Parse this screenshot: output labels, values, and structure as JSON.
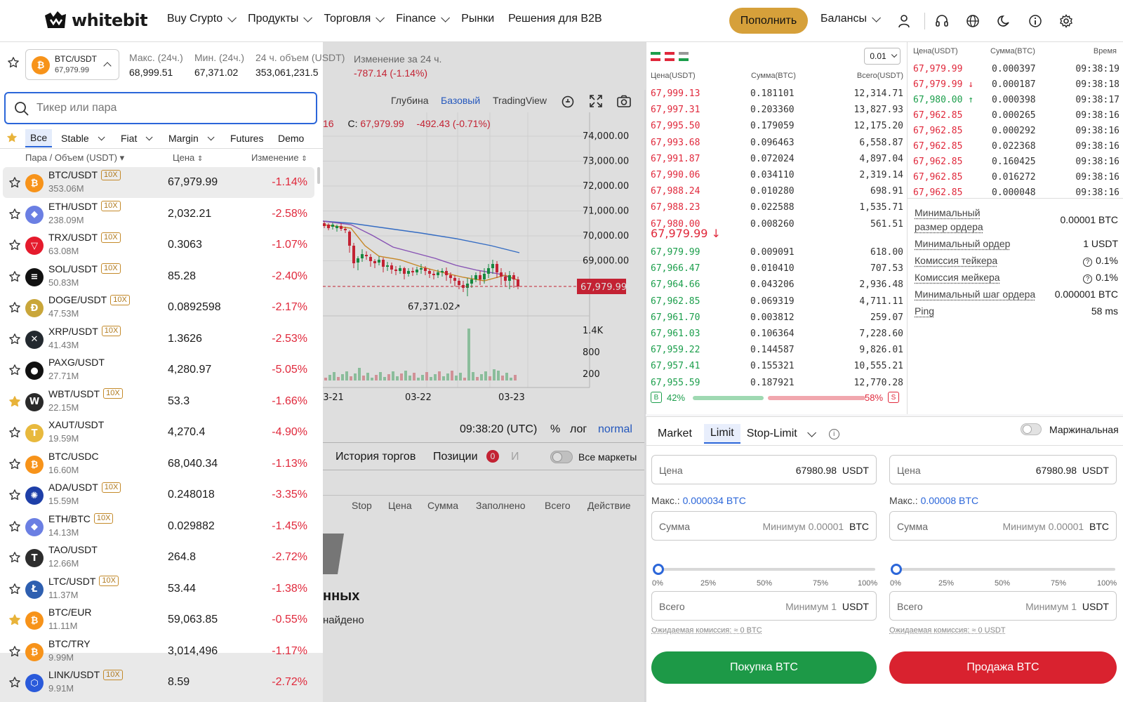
{
  "header": {
    "logo_text": "whitebit",
    "nav": [
      {
        "label": "Buy Crypto",
        "dropdown": true
      },
      {
        "label": "Продукты",
        "dropdown": true
      },
      {
        "label": "Торговля",
        "dropdown": true
      },
      {
        "label": "Finance",
        "dropdown": true
      },
      {
        "label": "Рынки",
        "dropdown": false
      },
      {
        "label": "Решения для B2B",
        "dropdown": false
      }
    ],
    "deposit_label": "Пополнить",
    "balances_label": "Балансы"
  },
  "colors": {
    "accent": "#d6a03a",
    "blue": "#2b66d9",
    "red": "#e0283b",
    "green": "#1b9e4b"
  },
  "market_panel": {
    "current_pair": "BTC/USDT",
    "current_price": "67,979.99",
    "stats": [
      {
        "label": "Макс. (24ч.)",
        "value": "68,999.51"
      },
      {
        "label": "Мин. (24ч.)",
        "value": "67,371.02"
      },
      {
        "label": "24 ч. объем (USDT)",
        "value": "353,061,231.5"
      },
      {
        "label": "Изменение за 24 ч.",
        "value": "-787.14  (-1.14%)"
      }
    ],
    "search_placeholder": "Тикер или пара",
    "filters": [
      "Все",
      "Stable",
      "Fiat",
      "Margin",
      "Futures",
      "Demo"
    ],
    "col_pair": "Пара / Объем (USDT)",
    "col_price": "Цена",
    "col_change": "Изменение",
    "rows": [
      {
        "pair": "BTC/USDT",
        "lev": "10X",
        "vol": "353.06M",
        "price": "67,979.99",
        "change": "-1.14%",
        "fav": false,
        "coin": "btc",
        "color": "#f7931a",
        "glyph": "₿"
      },
      {
        "pair": "ETH/USDT",
        "lev": "10X",
        "vol": "238.09M",
        "price": "2,032.21",
        "change": "-2.58%",
        "fav": false,
        "coin": "eth",
        "color": "#6b7fe3",
        "glyph": "◆"
      },
      {
        "pair": "TRX/USDT",
        "lev": "10X",
        "vol": "63.08M",
        "price": "0.3063",
        "change": "-1.07%",
        "fav": false,
        "coin": "trx",
        "color": "#e51a2c",
        "glyph": "▽"
      },
      {
        "pair": "SOL/USDT",
        "lev": "10X",
        "vol": "50.83M",
        "price": "85.28",
        "change": "-2.40%",
        "fav": false,
        "coin": "sol",
        "color": "#111111",
        "glyph": "≡"
      },
      {
        "pair": "DOGE/USDT",
        "lev": "10X",
        "vol": "47.53M",
        "price": "0.0892598",
        "change": "-2.17%",
        "fav": false,
        "coin": "doge",
        "color": "#c9a63a",
        "glyph": "Ð"
      },
      {
        "pair": "XRP/USDT",
        "lev": "10X",
        "vol": "41.43M",
        "price": "1.3626",
        "change": "-2.53%",
        "fav": false,
        "coin": "xrp",
        "color": "#23292f",
        "glyph": "✕"
      },
      {
        "pair": "PAXG/USDT",
        "lev": "",
        "vol": "27.71M",
        "price": "4,280.97",
        "change": "-5.05%",
        "fav": false,
        "coin": "paxg",
        "color": "#111111",
        "glyph": "●"
      },
      {
        "pair": "WBT/USDT",
        "lev": "10X",
        "vol": "22.15M",
        "price": "53.3",
        "change": "-1.66%",
        "fav": true,
        "coin": "wbt",
        "color": "#2a2a2a",
        "glyph": "W"
      },
      {
        "pair": "XAUT/USDT",
        "lev": "",
        "vol": "19.59M",
        "price": "4,270.4",
        "change": "-4.90%",
        "fav": false,
        "coin": "xaut",
        "color": "#e8b93d",
        "glyph": "T"
      },
      {
        "pair": "BTC/USDC",
        "lev": "",
        "vol": "16.60M",
        "price": "68,040.34",
        "change": "-1.13%",
        "fav": false,
        "coin": "btc",
        "color": "#f7931a",
        "glyph": "₿"
      },
      {
        "pair": "ADA/USDT",
        "lev": "10X",
        "vol": "15.59M",
        "price": "0.248018",
        "change": "-3.35%",
        "fav": false,
        "coin": "ada",
        "color": "#1e3fa8",
        "glyph": "✺"
      },
      {
        "pair": "ETH/BTC",
        "lev": "10X",
        "vol": "14.13M",
        "price": "0.029882",
        "change": "-1.45%",
        "fav": false,
        "coin": "eth",
        "color": "#6b7fe3",
        "glyph": "◆"
      },
      {
        "pair": "TAO/USDT",
        "lev": "",
        "vol": "12.66M",
        "price": "264.8",
        "change": "-2.72%",
        "fav": false,
        "coin": "tao",
        "color": "#2d2d2d",
        "glyph": "T"
      },
      {
        "pair": "LTC/USDT",
        "lev": "10X",
        "vol": "11.37M",
        "price": "53.44",
        "change": "-1.38%",
        "fav": false,
        "coin": "ltc",
        "color": "#2e5fb0",
        "glyph": "Ł"
      },
      {
        "pair": "BTC/EUR",
        "lev": "",
        "vol": "11.11M",
        "price": "59,063.85",
        "change": "-0.55%",
        "fav": true,
        "coin": "btc",
        "color": "#f7931a",
        "glyph": "₿"
      },
      {
        "pair": "BTC/TRY",
        "lev": "",
        "vol": "9.99M",
        "price": "3,014,496",
        "change": "-1.17%",
        "fav": false,
        "coin": "btc",
        "color": "#f7931a",
        "glyph": "₿"
      },
      {
        "pair": "LINK/USDT",
        "lev": "10X",
        "vol": "9.91M",
        "price": "8.59",
        "change": "-2.72%",
        "fav": false,
        "coin": "link",
        "color": "#2a5ada",
        "glyph": "⬡"
      }
    ]
  },
  "chart": {
    "toolbar": [
      "Глубина",
      "Базовый",
      "TradingView"
    ],
    "ohlc_partial": "16",
    "close_label": "C:",
    "close_value": "67,979.99",
    "change_value": "-492.43 (-0.71%)",
    "price_ticks": [
      "74,000.00",
      "73,000.00",
      "72,000.00",
      "71,000.00",
      "70,000.00",
      "69,000.00"
    ],
    "price_tag": "67,979.99",
    "low_marker": "67,371.02",
    "volume_ticks": [
      "1.4K",
      "800",
      "200"
    ],
    "date_ticks": [
      "03-21",
      "03-22",
      "03-23"
    ],
    "time": "09:38:20 (UTC)",
    "pct_label": "%",
    "log_label": "лог",
    "mode_label": "normal"
  },
  "bottom": {
    "tabs": [
      "История торгов",
      "Позиции"
    ],
    "positions_count": "0",
    "tab_cut": "И",
    "all_markets_label": "Все маркеты",
    "columns": [
      "Stop",
      "Цена",
      "Сумма",
      "Заполнено",
      "Всего",
      "Действие"
    ],
    "empty_title_partial": "нных",
    "empty_sub_partial": "найдено"
  },
  "orderbook": {
    "step": "0.01",
    "headers": [
      "Цена(USDT)",
      "Сумма(BTC)",
      "Всего(USDT)"
    ],
    "asks": [
      {
        "price": "67,999.13",
        "amount": "0.181101",
        "total": "12,314.71"
      },
      {
        "price": "67,997.31",
        "amount": "0.203360",
        "total": "13,827.93"
      },
      {
        "price": "67,995.50",
        "amount": "0.179059",
        "total": "12,175.20"
      },
      {
        "price": "67,993.68",
        "amount": "0.096463",
        "total": "6,558.87"
      },
      {
        "price": "67,991.87",
        "amount": "0.072024",
        "total": "4,897.04"
      },
      {
        "price": "67,990.06",
        "amount": "0.034110",
        "total": "2,319.14"
      },
      {
        "price": "67,988.24",
        "amount": "0.010280",
        "total": "698.91"
      },
      {
        "price": "67,988.23",
        "amount": "0.022588",
        "total": "1,535.71"
      },
      {
        "price": "67,980.00",
        "amount": "0.008260",
        "total": "561.51"
      }
    ],
    "mid_price": "67,979.99 ↓",
    "bids": [
      {
        "price": "67,979.99",
        "amount": "0.009091",
        "total": "618.00"
      },
      {
        "price": "67,966.47",
        "amount": "0.010410",
        "total": "707.53"
      },
      {
        "price": "67,964.66",
        "amount": "0.043206",
        "total": "2,936.48"
      },
      {
        "price": "67,962.85",
        "amount": "0.069319",
        "total": "4,711.11"
      },
      {
        "price": "67,961.70",
        "amount": "0.003812",
        "total": "259.07"
      },
      {
        "price": "67,961.03",
        "amount": "0.106364",
        "total": "7,228.60"
      },
      {
        "price": "67,959.22",
        "amount": "0.144587",
        "total": "9,826.01"
      },
      {
        "price": "67,957.41",
        "amount": "0.155321",
        "total": "10,555.21"
      },
      {
        "price": "67,955.59",
        "amount": "0.187921",
        "total": "12,770.28"
      }
    ],
    "buy_letter": "B",
    "buy_pct": "42%",
    "sell_pct": "58%",
    "sell_letter": "S",
    "buy_ratio": 0.42
  },
  "trades": {
    "headers": [
      "Цена(USDT)",
      "Сумма(BTC)",
      "Время"
    ],
    "rows": [
      {
        "price": "67,979.99",
        "amount": "0.000397",
        "time": "09:38:19",
        "side": "sell"
      },
      {
        "price": "67,979.99 ↓",
        "amount": "0.000187",
        "time": "09:38:18",
        "side": "sell"
      },
      {
        "price": "67,980.00 ↑",
        "amount": "0.000398",
        "time": "09:38:17",
        "side": "buy"
      },
      {
        "price": "67,962.85",
        "amount": "0.000265",
        "time": "09:38:16",
        "side": "sell"
      },
      {
        "price": "67,962.85",
        "amount": "0.000292",
        "time": "09:38:16",
        "side": "sell"
      },
      {
        "price": "67,962.85",
        "amount": "0.022368",
        "time": "09:38:16",
        "side": "sell"
      },
      {
        "price": "67,962.85",
        "amount": "0.160425",
        "time": "09:38:16",
        "side": "sell"
      },
      {
        "price": "67,962.85",
        "amount": "0.016272",
        "time": "09:38:16",
        "side": "sell"
      },
      {
        "price": "67,962.85",
        "amount": "0.000048",
        "time": "09:38:16",
        "side": "sell"
      }
    ]
  },
  "params": [
    {
      "label": "Минимальный размер ордера",
      "value": "0.00001 BTC"
    },
    {
      "label": "Минимальный ордер",
      "value": "1 USDT"
    },
    {
      "label": "Комиссия тейкера",
      "value": "0.1%"
    },
    {
      "label": "Комиссия мейкера",
      "value": "0.1%"
    },
    {
      "label": "Минимальный шаг ордера",
      "value": "0.000001 BTC"
    },
    {
      "label": "Ping",
      "value": "58 ms"
    }
  ],
  "order_form": {
    "types": [
      "Market",
      "Limit",
      "Stop-Limit"
    ],
    "margin_label": "Маржинальная",
    "buy": {
      "price_label": "Цена",
      "price_value": "67980.98",
      "price_unit": "USDT",
      "max_label": "Макс.:",
      "max_value": "0.000034 BTC",
      "amount_label": "Сумма",
      "amount_hint": "Минимум 0.00001",
      "amount_unit": "BTC",
      "total_label": "Всего",
      "total_hint": "Минимум 1",
      "total_unit": "USDT",
      "fee": "Ожидаемая комиссия: ≈ 0 BTC",
      "submit": "Покупка BTC"
    },
    "sell": {
      "price_label": "Цена",
      "price_value": "67980.98",
      "price_unit": "USDT",
      "max_label": "Макс.:",
      "max_value": "0.00008 BTC",
      "amount_label": "Сумма",
      "amount_hint": "Минимум 0.00001",
      "amount_unit": "BTC",
      "total_label": "Всего",
      "total_hint": "Минимум 1",
      "total_unit": "USDT",
      "fee": "Ожидаемая комиссия: ≈ 0 USDT",
      "submit": "Продажа BTC"
    },
    "slider_marks": [
      "0%",
      "25%",
      "50%",
      "75%",
      "100%"
    ],
    "slider_value": 0
  }
}
